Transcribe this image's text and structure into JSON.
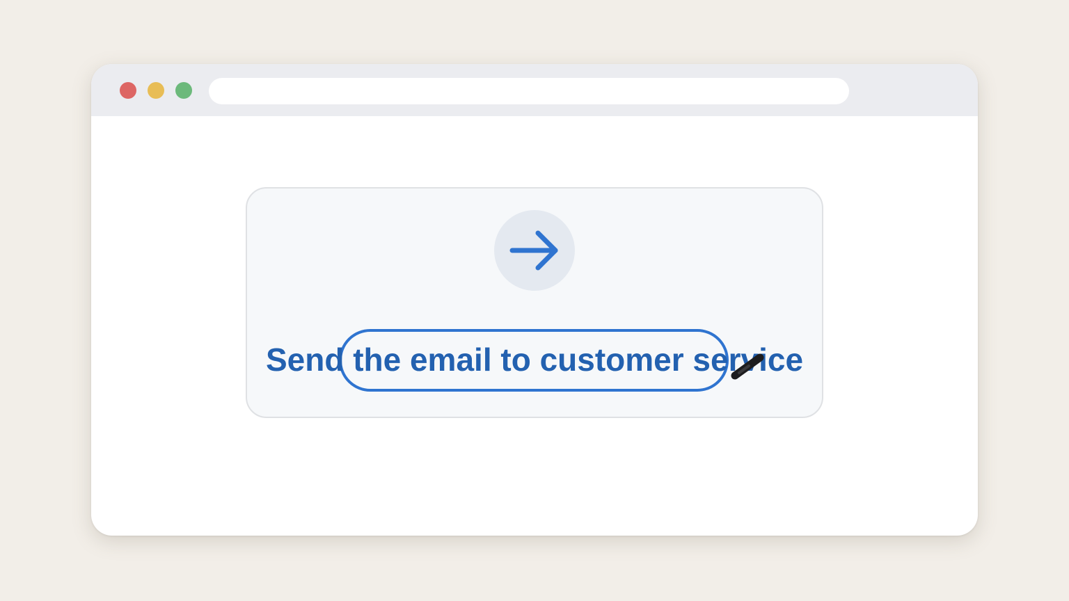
{
  "browser": {
    "address_value": "",
    "traffic_lights": {
      "close_color": "#dd6664",
      "minimize_color": "#e8bd56",
      "maximize_color": "#6cb97b"
    }
  },
  "card": {
    "icon": "arrow-right-icon",
    "instruction": "Send the email to customer service",
    "accent_color": "#2f74d0",
    "text_color": "#2361b0"
  }
}
